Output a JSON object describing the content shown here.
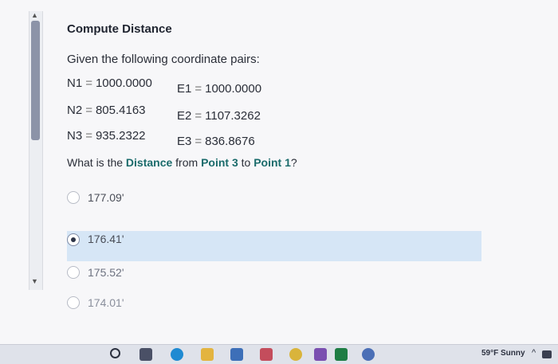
{
  "question": {
    "title": "Compute Distance",
    "intro": "Given the following coordinate pairs:",
    "coordinates": [
      {
        "n_label": "N1",
        "n_value": "1000.0000",
        "e_label": "E1",
        "e_value": "1000.0000"
      },
      {
        "n_label": "N2",
        "n_value": "805.4163",
        "e_label": "E2",
        "e_value": "1107.3262"
      },
      {
        "n_label": "N3",
        "n_value": "935.2322",
        "e_label": "E3",
        "e_value": "836.8676"
      }
    ],
    "equals": "=",
    "prompt_parts": {
      "a": "What is the ",
      "b": "Distance",
      "c": " from ",
      "d": "Point 3",
      "e": " to ",
      "f": "Point 1",
      "g": "?"
    }
  },
  "options": [
    {
      "label": "177.09'",
      "selected": false
    },
    {
      "label": "176.41'",
      "selected": true
    },
    {
      "label": "175.52'",
      "selected": false
    },
    {
      "label": "174.01'",
      "selected": false
    }
  ],
  "taskbar": {
    "weather": "59°F Sunny",
    "icons": [
      "search-icon",
      "task-view-icon",
      "edge-icon",
      "file-explorer-icon",
      "store-icon",
      "app-icon",
      "chrome-icon",
      "app-icon",
      "excel-icon",
      "settings-icon"
    ]
  },
  "colors": {
    "highlight_text": "#1a6b6b",
    "selected_row": "#d6e6f6"
  }
}
